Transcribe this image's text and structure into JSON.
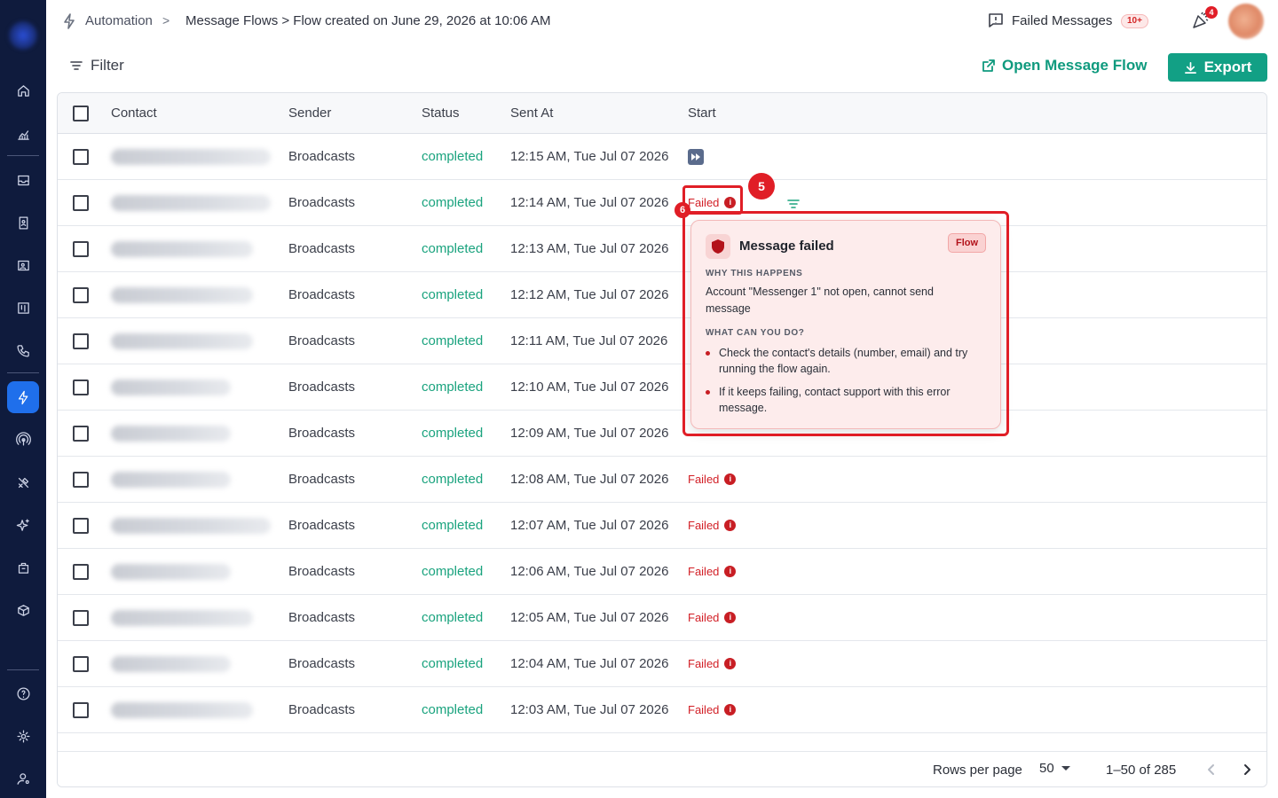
{
  "breadcrumb": {
    "root": "Automation",
    "path": "Message Flows > Flow created on June 29, 2026 at 10:06 AM"
  },
  "header": {
    "failed_messages_label": "Failed Messages",
    "failed_messages_badge": "10+",
    "notifications_badge": "4"
  },
  "toolbar": {
    "filter_label": "Filter",
    "open_flow_label": "Open Message Flow",
    "export_label": "Export"
  },
  "table": {
    "columns": [
      "Contact",
      "Sender",
      "Status",
      "Sent At",
      "Start"
    ],
    "rows": [
      {
        "sender": "Broadcasts",
        "status": "completed",
        "sent_at": "12:15 AM, Tue Jul 07 2026",
        "start": "icon"
      },
      {
        "sender": "Broadcasts",
        "status": "completed",
        "sent_at": "12:14 AM, Tue Jul 07 2026",
        "start": "Failed"
      },
      {
        "sender": "Broadcasts",
        "status": "completed",
        "sent_at": "12:13 AM, Tue Jul 07 2026",
        "start": ""
      },
      {
        "sender": "Broadcasts",
        "status": "completed",
        "sent_at": "12:12 AM, Tue Jul 07 2026",
        "start": ""
      },
      {
        "sender": "Broadcasts",
        "status": "completed",
        "sent_at": "12:11 AM, Tue Jul 07 2026",
        "start": ""
      },
      {
        "sender": "Broadcasts",
        "status": "completed",
        "sent_at": "12:10 AM, Tue Jul 07 2026",
        "start": ""
      },
      {
        "sender": "Broadcasts",
        "status": "completed",
        "sent_at": "12:09 AM, Tue Jul 07 2026",
        "start": ""
      },
      {
        "sender": "Broadcasts",
        "status": "completed",
        "sent_at": "12:08 AM, Tue Jul 07 2026",
        "start": "Failed"
      },
      {
        "sender": "Broadcasts",
        "status": "completed",
        "sent_at": "12:07 AM, Tue Jul 07 2026",
        "start": "Failed"
      },
      {
        "sender": "Broadcasts",
        "status": "completed",
        "sent_at": "12:06 AM, Tue Jul 07 2026",
        "start": "Failed"
      },
      {
        "sender": "Broadcasts",
        "status": "completed",
        "sent_at": "12:05 AM, Tue Jul 07 2026",
        "start": "Failed"
      },
      {
        "sender": "Broadcasts",
        "status": "completed",
        "sent_at": "12:04 AM, Tue Jul 07 2026",
        "start": "Failed"
      },
      {
        "sender": "Broadcasts",
        "status": "completed",
        "sent_at": "12:03 AM, Tue Jul 07 2026",
        "start": "Failed"
      }
    ]
  },
  "pagination": {
    "rows_per_page_label": "Rows per page",
    "rows_per_page_value": "50",
    "range": "1–50 of 285"
  },
  "popover": {
    "title": "Message failed",
    "tag": "Flow",
    "why_heading": "WHY THIS HAPPENS",
    "why_text": "Account \"Messenger 1\" not open, cannot send message",
    "what_heading": "WHAT CAN YOU DO?",
    "tips": [
      "Check the contact's details (number, email) and try running the flow again.",
      "If it keeps failing, contact support with this error message."
    ]
  },
  "annotations": {
    "marker_5": "5",
    "marker_6": "6"
  },
  "colors": {
    "sidebar_bg": "#0f1b3d",
    "sidebar_active": "#1f6feb",
    "accent_green": "#12a085",
    "status_green": "#1aa37e",
    "failed_red": "#d21f26",
    "highlight_red": "#e01e26"
  },
  "icons": {
    "sidebar": [
      "home-icon",
      "chart-icon",
      "inbox-icon",
      "contact-book-icon",
      "id-card-icon",
      "kanban-icon",
      "phone-icon",
      "bolt-icon",
      "broadcast-icon",
      "tools-icon",
      "sparkles-icon",
      "briefcase-icon",
      "box-gear-icon",
      "help-icon",
      "settings-icon",
      "user-settings-icon"
    ]
  }
}
